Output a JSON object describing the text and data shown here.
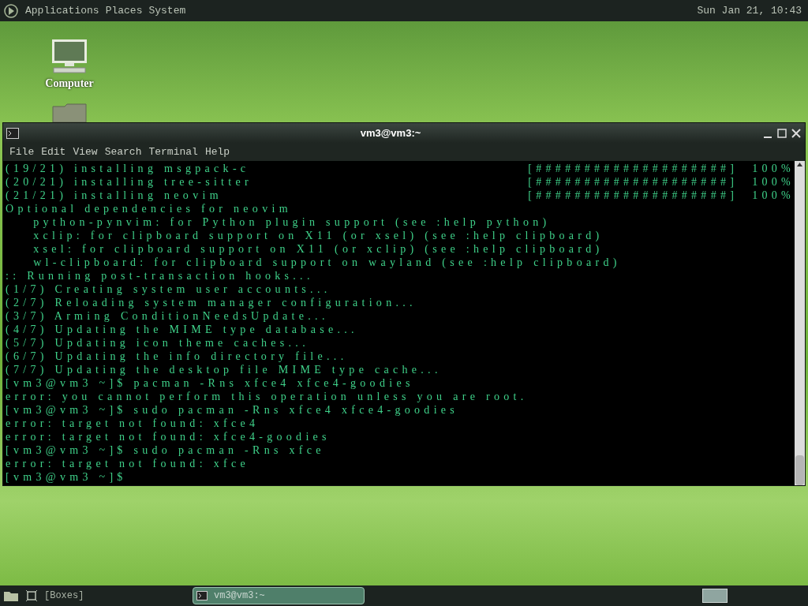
{
  "top_panel": {
    "menus": [
      "Applications",
      "Places",
      "System"
    ],
    "clock": "Sun Jan 21, 10:43"
  },
  "desktop_icons": [
    {
      "kind": "computer",
      "label": "Computer"
    },
    {
      "kind": "folder"
    }
  ],
  "window": {
    "title": "vm3@vm3:~",
    "menu": [
      "File",
      "Edit",
      "View",
      "Search",
      "Terminal",
      "Help"
    ]
  },
  "terminal_lines": [
    {
      "kind": "progress",
      "text": "(19/21) installing msgpack-c",
      "bar": "[####################]",
      "percent": "100%"
    },
    {
      "kind": "progress",
      "text": "(20/21) installing tree-sitter",
      "bar": "[####################]",
      "percent": "100%"
    },
    {
      "kind": "progress",
      "text": "(21/21) installing neovim",
      "bar": "[####################]",
      "percent": "100%"
    },
    {
      "kind": "text",
      "text": "Optional dependencies for neovim"
    },
    {
      "kind": "text",
      "text": "    python-pynvim: for Python plugin support (see :help python)"
    },
    {
      "kind": "text",
      "text": "    xclip: for clipboard support on X11 (or xsel) (see :help clipboard)"
    },
    {
      "kind": "text",
      "text": "    xsel: for clipboard support on X11 (or xclip) (see :help clipboard)"
    },
    {
      "kind": "text",
      "text": "    wl-clipboard: for clipboard support on wayland (see :help clipboard)"
    },
    {
      "kind": "text",
      "text": ":: Running post-transaction hooks..."
    },
    {
      "kind": "text",
      "text": "(1/7) Creating system user accounts..."
    },
    {
      "kind": "text",
      "text": "(2/7) Reloading system manager configuration..."
    },
    {
      "kind": "text",
      "text": "(3/7) Arming ConditionNeedsUpdate..."
    },
    {
      "kind": "text",
      "text": "(4/7) Updating the MIME type database..."
    },
    {
      "kind": "text",
      "text": "(5/7) Updating icon theme caches..."
    },
    {
      "kind": "text",
      "text": "(6/7) Updating the info directory file..."
    },
    {
      "kind": "text",
      "text": "(7/7) Updating the desktop file MIME type cache..."
    },
    {
      "kind": "text",
      "text": "[vm3@vm3 ~]$ pacman -Rns xfce4 xfce4-goodies"
    },
    {
      "kind": "text",
      "text": "error: you cannot perform this operation unless you are root."
    },
    {
      "kind": "text",
      "text": "[vm3@vm3 ~]$ sudo pacman -Rns xfce4 xfce4-goodies"
    },
    {
      "kind": "text",
      "text": "error: target not found: xfce4"
    },
    {
      "kind": "text",
      "text": "error: target not found: xfce4-goodies"
    },
    {
      "kind": "text",
      "text": "[vm3@vm3 ~]$ sudo pacman -Rns xfce"
    },
    {
      "kind": "text",
      "text": "error: target not found: xfce"
    },
    {
      "kind": "text",
      "text": "[vm3@vm3 ~]$"
    }
  ],
  "taskbar": {
    "workspace_label": "[Boxes]",
    "tasks": [
      {
        "title": "vm3@vm3:~",
        "selected": true
      }
    ]
  }
}
